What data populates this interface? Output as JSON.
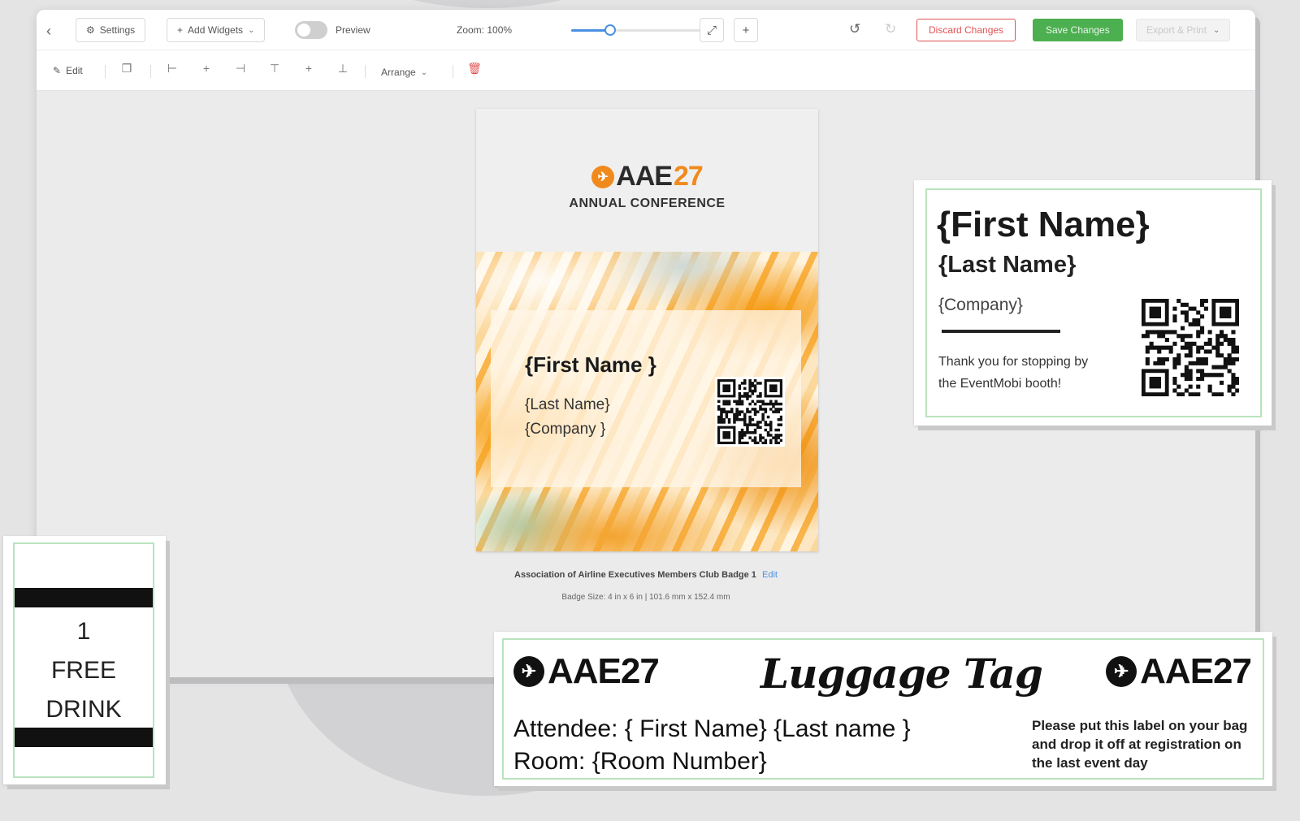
{
  "toolbar": {
    "back_icon": "chevron-left-icon",
    "settings_label": "Settings",
    "add_widgets_label": "Add Widgets",
    "preview_label": "Preview",
    "zoom_label": "Zoom: 100%",
    "zoom_fraction": 0.26,
    "discard_label": "Discard Changes",
    "save_label": "Save Changes",
    "export_label": "Export & Print",
    "accent_color": "#4a90e2",
    "save_color": "#4caf50",
    "discard_color": "#e05353"
  },
  "edit_toolbar": {
    "edit_label": "Edit",
    "arrange_label": "Arrange"
  },
  "badge": {
    "logo_text_dark": "AAE",
    "logo_text_orange": "27",
    "conference": "ANNUAL CONFERENCE",
    "first_name": "{First Name }",
    "last_name": "{Last Name}",
    "company": "{Company }",
    "caption": "Association of Airline Executives Members Club Badge 1",
    "caption_edit": "Edit",
    "size": "Badge Size: 4 in x 6 in | 101.6 mm x 152.4 mm",
    "brand_orange": "#f08a1c"
  },
  "sticker": {
    "first_name": "{First Name}",
    "last_name": "{Last Name}",
    "company": "{Company}",
    "message_line1": "Thank you for stopping by",
    "message_line2": "the EventMobi booth!"
  },
  "drink": {
    "line1": "1",
    "line2": "FREE",
    "line3": "DRINK"
  },
  "luggage": {
    "logo_left": "AAE27",
    "title": "Luggage Tag",
    "logo_right": "AAE27",
    "attendee": "Attendee: { First Name} {Last name }",
    "room": "Room: {Room Number}",
    "note_line1": "Please put this label on your bag",
    "note_line2": "and drop it off at registration on",
    "note_line3": "the last event day"
  }
}
